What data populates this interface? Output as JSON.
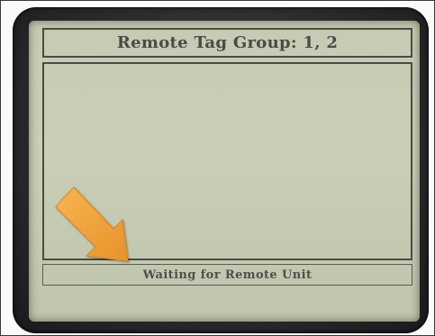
{
  "device_screen": {
    "title": "Remote Tag Group: 1, 2",
    "status": "Waiting for Remote Unit"
  },
  "annotation": {
    "icon": "arrow-pointer-icon",
    "color": "#f0a13c"
  },
  "colors": {
    "lcd_background": "#c6cbb3",
    "lcd_text": "#4a4c44",
    "bezel": "#2b2b2b"
  }
}
